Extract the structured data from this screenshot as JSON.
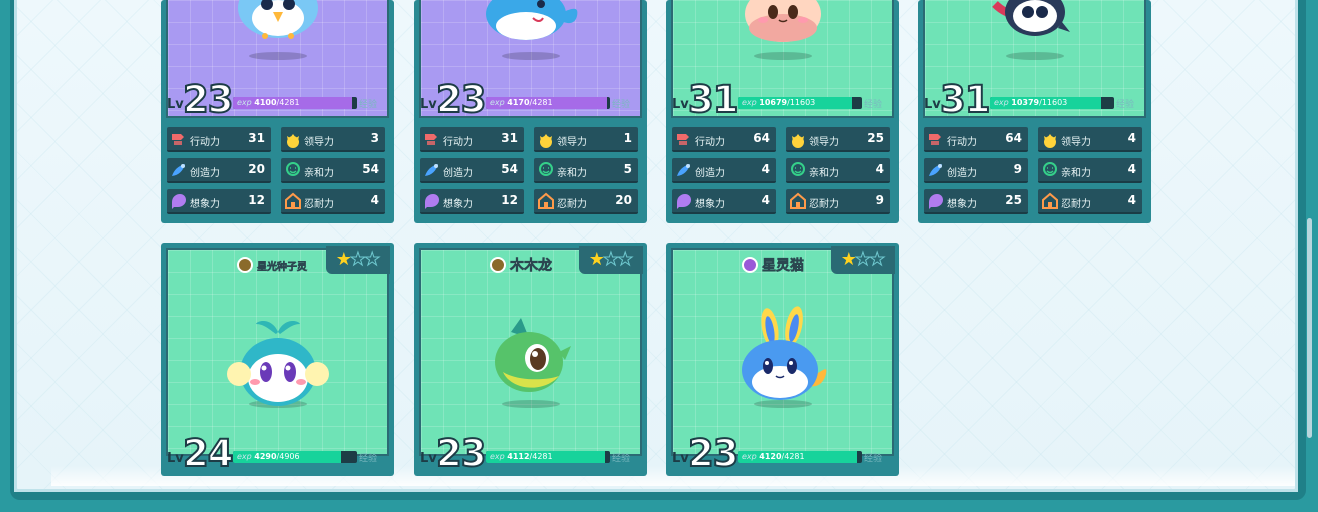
{
  "top_cards": [
    {
      "art": "purple",
      "level": "23",
      "exp_current": "4100",
      "exp_max": "/4281",
      "exp_ratio": 0.958,
      "exp_color": "#a66be8",
      "exp_label": "exp",
      "jy_label": "经验",
      "stats": [
        {
          "name": "行动力",
          "value": "31",
          "icon": "action-icon",
          "color": "#f06a6a"
        },
        {
          "name": "领导力",
          "value": "3",
          "icon": "leadership-icon",
          "color": "#ffd43b"
        },
        {
          "name": "创造力",
          "value": "20",
          "icon": "creativity-icon",
          "color": "#4aa3ff"
        },
        {
          "name": "亲和力",
          "value": "54",
          "icon": "affinity-icon",
          "color": "#35d08a"
        },
        {
          "name": "想象力",
          "value": "12",
          "icon": "imagination-icon",
          "color": "#b07cf0"
        },
        {
          "name": "忍耐力",
          "value": "4",
          "icon": "endurance-icon",
          "color": "#ff9a4a"
        }
      ]
    },
    {
      "art": "purple",
      "level": "23",
      "exp_current": "4170",
      "exp_max": "/4281",
      "exp_ratio": 0.974,
      "exp_color": "#a66be8",
      "exp_label": "exp",
      "jy_label": "经验",
      "stats": [
        {
          "name": "行动力",
          "value": "31",
          "icon": "action-icon",
          "color": "#f06a6a"
        },
        {
          "name": "领导力",
          "value": "1",
          "icon": "leadership-icon",
          "color": "#ffd43b"
        },
        {
          "name": "创造力",
          "value": "54",
          "icon": "creativity-icon",
          "color": "#4aa3ff"
        },
        {
          "name": "亲和力",
          "value": "5",
          "icon": "affinity-icon",
          "color": "#35d08a"
        },
        {
          "name": "想象力",
          "value": "12",
          "icon": "imagination-icon",
          "color": "#b07cf0"
        },
        {
          "name": "忍耐力",
          "value": "20",
          "icon": "endurance-icon",
          "color": "#ff9a4a"
        }
      ]
    },
    {
      "art": "green",
      "level": "31",
      "exp_current": "10679",
      "exp_max": "/11603",
      "exp_ratio": 0.92,
      "exp_color": "#17d39b",
      "exp_label": "exp",
      "jy_label": "经验",
      "stats": [
        {
          "name": "行动力",
          "value": "64",
          "icon": "action-icon",
          "color": "#f06a6a"
        },
        {
          "name": "领导力",
          "value": "25",
          "icon": "leadership-icon",
          "color": "#ffd43b"
        },
        {
          "name": "创造力",
          "value": "4",
          "icon": "creativity-icon",
          "color": "#4aa3ff"
        },
        {
          "name": "亲和力",
          "value": "4",
          "icon": "affinity-icon",
          "color": "#35d08a"
        },
        {
          "name": "想象力",
          "value": "4",
          "icon": "imagination-icon",
          "color": "#b07cf0"
        },
        {
          "name": "忍耐力",
          "value": "9",
          "icon": "endurance-icon",
          "color": "#ff9a4a"
        }
      ]
    },
    {
      "art": "green",
      "level": "31",
      "exp_current": "10379",
      "exp_max": "/11603",
      "exp_ratio": 0.894,
      "exp_color": "#17d39b",
      "exp_label": "exp",
      "jy_label": "经验",
      "stats": [
        {
          "name": "行动力",
          "value": "64",
          "icon": "action-icon",
          "color": "#f06a6a"
        },
        {
          "name": "领导力",
          "value": "4",
          "icon": "leadership-icon",
          "color": "#ffd43b"
        },
        {
          "name": "创造力",
          "value": "9",
          "icon": "creativity-icon",
          "color": "#4aa3ff"
        },
        {
          "name": "亲和力",
          "value": "4",
          "icon": "affinity-icon",
          "color": "#35d08a"
        },
        {
          "name": "想象力",
          "value": "25",
          "icon": "imagination-icon",
          "color": "#b07cf0"
        },
        {
          "name": "忍耐力",
          "value": "4",
          "icon": "endurance-icon",
          "color": "#ff9a4a"
        }
      ]
    }
  ],
  "bottom_cards": [
    {
      "name": "星光种子灵",
      "element_color": "#8a6a2a",
      "stars_on": 1,
      "stars_total": 3,
      "level": "24",
      "exp_current": "4290",
      "exp_max": "/4906",
      "exp_ratio": 0.874,
      "exp_color": "#17d39b",
      "exp_label": "exp",
      "jy_label": "经验",
      "pet": "sprout"
    },
    {
      "name": "木木龙",
      "element_color": "#8a6a2a",
      "stars_on": 1,
      "stars_total": 3,
      "level": "23",
      "exp_current": "4112",
      "exp_max": "/4281",
      "exp_ratio": 0.96,
      "exp_color": "#17d39b",
      "exp_label": "exp",
      "jy_label": "经验",
      "pet": "dragon"
    },
    {
      "name": "星灵猫",
      "element_color": "#9a5ad8",
      "stars_on": 1,
      "stars_total": 3,
      "level": "23",
      "exp_current": "4120",
      "exp_max": "/4281",
      "exp_ratio": 0.962,
      "exp_color": "#17d39b",
      "exp_label": "exp",
      "jy_label": "经验",
      "pet": "cat"
    }
  ]
}
